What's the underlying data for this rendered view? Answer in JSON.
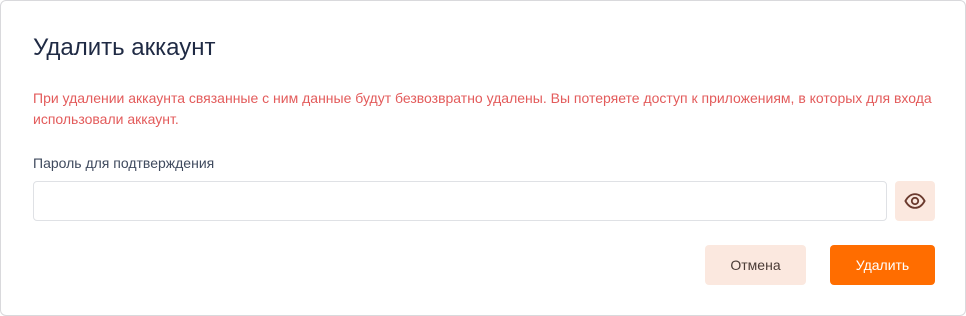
{
  "dialog": {
    "title": "Удалить аккаунт",
    "warning": "При удалении аккаунта связанные с ним данные будут безвозвратно удалены. Вы потеряете доступ к приложениям, в которых для входа использовали аккаунт.",
    "password_label": "Пароль для подтверждения",
    "password_value": "",
    "password_placeholder": "",
    "toggle_icon": "eye-icon",
    "cancel_label": "Отмена",
    "delete_label": "Удалить"
  },
  "colors": {
    "title": "#1f2a44",
    "warning": "#e35b5b",
    "accent": "#ff6d00",
    "secondary_button_bg": "#fbe8df",
    "icon": "#6b3a2e"
  }
}
